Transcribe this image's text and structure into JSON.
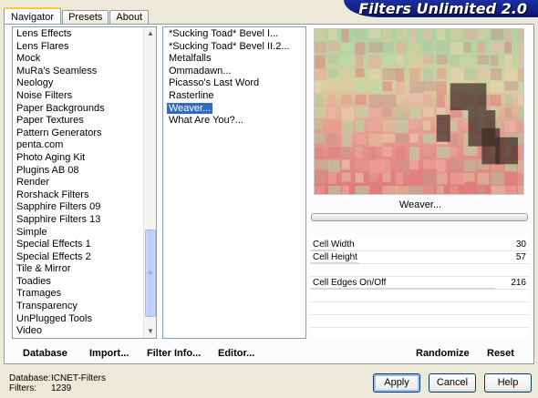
{
  "tabs": [
    "Navigator",
    "Presets",
    "About"
  ],
  "banner_title": "Filters Unlimited 2.0",
  "categories": [
    "Lens Effects",
    "Lens Flares",
    "Mock",
    "MuRa's Seamless",
    "Neology",
    "Noise Filters",
    "Paper Backgrounds",
    "Paper Textures",
    "Pattern Generators",
    "penta.com",
    "Photo Aging Kit",
    "Plugins AB 08",
    "Render",
    "Rorshack Filters",
    "Sapphire Filters 09",
    "Sapphire Filters 13",
    "Simple",
    "Special Effects 1",
    "Special Effects 2",
    "Tile & Mirror",
    "Toadies",
    "Tramages",
    "Transparency",
    "UnPlugged Tools",
    "Video"
  ],
  "filters": [
    "*Sucking Toad* Bevel I...",
    "*Sucking Toad* Bevel II.2...",
    "Metalfalls",
    "Ommadawn...",
    "Picasso's Last Word",
    "Rasterline",
    "Weaver...",
    "What Are You?..."
  ],
  "selected_filter": "Weaver...",
  "preview_caption": "Weaver...",
  "params": [
    {
      "label": "Cell Width",
      "value": "30"
    },
    {
      "label": "Cell Height",
      "value": "57"
    },
    {
      "label": "",
      "value": ""
    },
    {
      "label": "Cell Edges On/Off",
      "value": "216"
    }
  ],
  "bottom_buttons": {
    "database": "Database",
    "import": "Import...",
    "filter_info": "Filter Info...",
    "editor": "Editor...",
    "randomize": "Randomize",
    "reset": "Reset"
  },
  "info": {
    "database_label": "Database:",
    "database_value": "ICNET-Filters",
    "filters_label": "Filters:",
    "filters_value": "1239"
  },
  "dialog_buttons": {
    "apply": "Apply",
    "cancel": "Cancel",
    "help": "Help"
  },
  "colors": {
    "selection": "#316ac5",
    "banner": "#0a1570"
  }
}
